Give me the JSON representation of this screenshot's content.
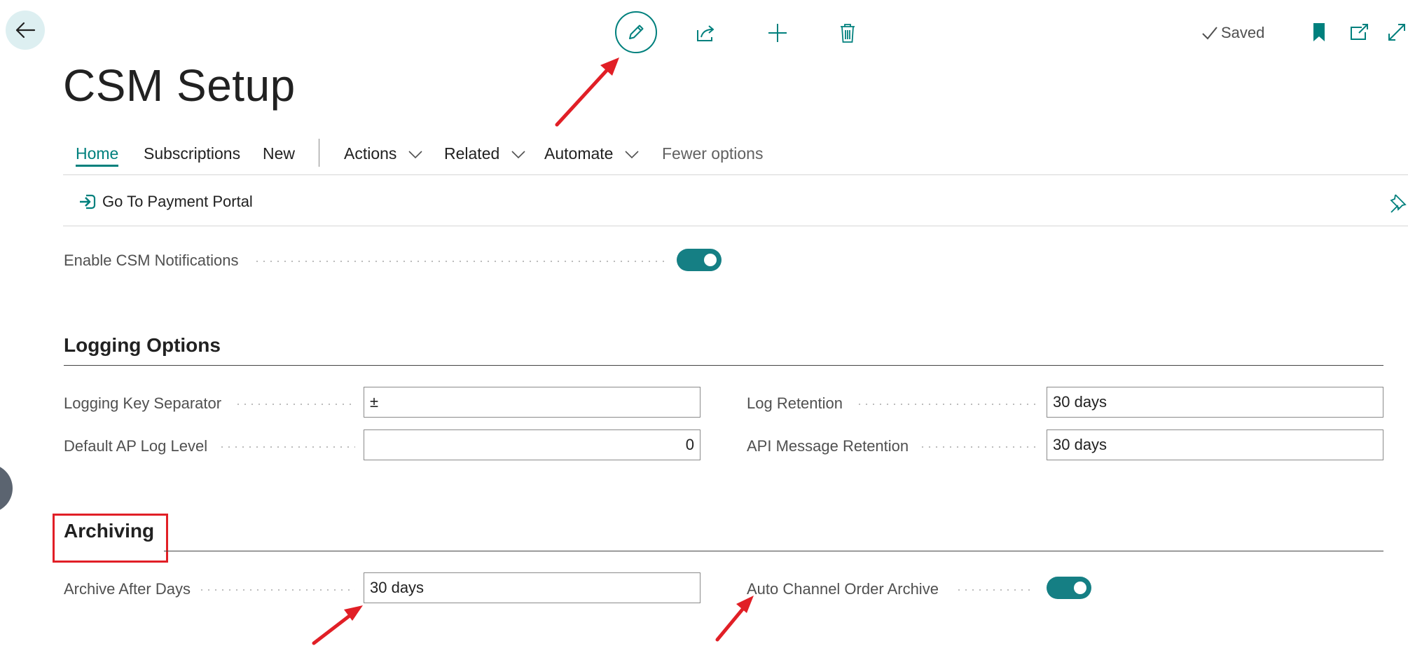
{
  "page": {
    "title": "CSM Setup",
    "status": "Saved"
  },
  "toolbar": {
    "icons": [
      "back-arrow-icon",
      "edit-pencil-icon",
      "share-icon",
      "plus-icon",
      "trash-icon",
      "checkmark-icon",
      "bookmark-icon",
      "open-new-window-icon",
      "expand-icon",
      "pin-icon"
    ]
  },
  "nav": {
    "tabs": [
      {
        "label": "Home"
      },
      {
        "label": "Subscriptions"
      },
      {
        "label": "New"
      },
      {
        "label": "Actions"
      },
      {
        "label": "Related"
      },
      {
        "label": "Automate"
      },
      {
        "label": "Fewer options"
      }
    ]
  },
  "actionbar": {
    "go_to_payment_portal": "Go To Payment Portal"
  },
  "general": {
    "enable_notifications_label": "Enable CSM Notifications",
    "enable_notifications_value": true
  },
  "logging": {
    "heading": "Logging Options",
    "key_separator_label": "Logging Key Separator",
    "key_separator_value": "±",
    "default_log_level_label": "Default AP Log Level",
    "default_log_level_value": "0",
    "log_retention_label": "Log Retention",
    "log_retention_value": "30 days",
    "api_message_retention_label": "API Message Retention",
    "api_message_retention_value": "30 days"
  },
  "archiving": {
    "heading": "Archiving",
    "archive_after_days_label": "Archive After Days",
    "archive_after_days_value": "30 days",
    "auto_channel_order_archive_label": "Auto Channel Order Archive",
    "auto_channel_order_archive_value": true
  },
  "colors": {
    "accent": "#00807d",
    "toggle_on": "#157f84",
    "annotation_red": "#e11f26"
  }
}
